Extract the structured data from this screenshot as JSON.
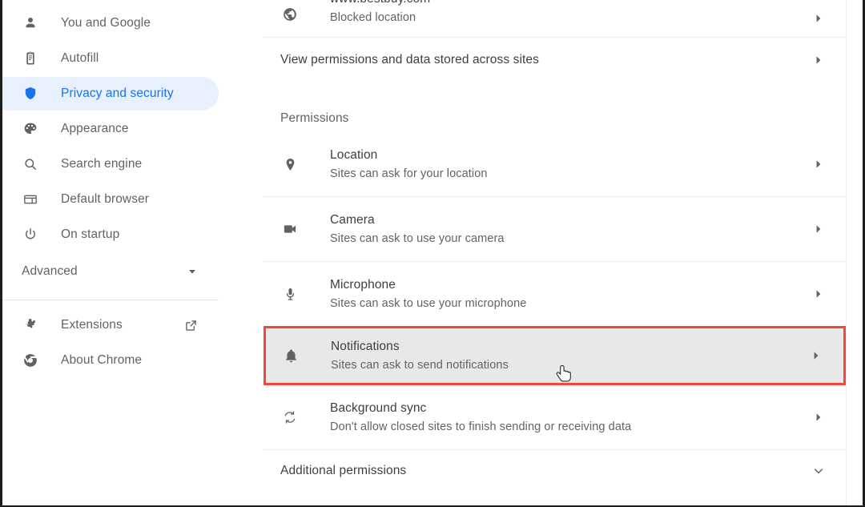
{
  "sidebar": {
    "items": [
      {
        "label": "You and Google",
        "icon": "person-icon",
        "selected": false
      },
      {
        "label": "Autofill",
        "icon": "clipboard-icon",
        "selected": false
      },
      {
        "label": "Privacy and security",
        "icon": "shield-icon",
        "selected": true
      },
      {
        "label": "Appearance",
        "icon": "palette-icon",
        "selected": false
      },
      {
        "label": "Search engine",
        "icon": "search-icon",
        "selected": false
      },
      {
        "label": "Default browser",
        "icon": "browser-window-icon",
        "selected": false
      },
      {
        "label": "On startup",
        "icon": "power-icon",
        "selected": false
      }
    ],
    "advanced": {
      "label": "Advanced",
      "icon": "chevron-down-icon"
    },
    "footer": [
      {
        "label": "Extensions",
        "icon": "puzzle-icon",
        "trailing_icon": "external-link-icon"
      },
      {
        "label": "About Chrome",
        "icon": "chrome-logo-icon"
      }
    ],
    "selected_accent": "#1a73e8",
    "selected_background": "#e8f0fe"
  },
  "main": {
    "site_row": {
      "title": "www.bestbuy.com",
      "subtitle": "Blocked location",
      "icon": "globe-icon",
      "arrow": "chevron-right-icon"
    },
    "view_permissions": {
      "label": "View permissions and data stored across sites",
      "arrow": "chevron-right-icon"
    },
    "permissions_heading": "Permissions",
    "permissions": [
      {
        "name": "location",
        "title": "Location",
        "subtitle": "Sites can ask for your location",
        "icon": "location-pin-icon",
        "arrow": "chevron-right-icon",
        "highlighted": false
      },
      {
        "name": "camera",
        "title": "Camera",
        "subtitle": "Sites can ask to use your camera",
        "icon": "video-camera-icon",
        "arrow": "chevron-right-icon",
        "highlighted": false
      },
      {
        "name": "microphone",
        "title": "Microphone",
        "subtitle": "Sites can ask to use your microphone",
        "icon": "microphone-icon",
        "arrow": "chevron-right-icon",
        "highlighted": false
      },
      {
        "name": "notifications",
        "title": "Notifications",
        "subtitle": "Sites can ask to send notifications",
        "icon": "bell-icon",
        "arrow": "chevron-right-icon",
        "highlighted": true
      },
      {
        "name": "background-sync",
        "title": "Background sync",
        "subtitle": "Don't allow closed sites to finish sending or receiving data",
        "icon": "sync-icon",
        "arrow": "chevron-right-icon",
        "highlighted": false
      }
    ],
    "additional_permissions": {
      "label": "Additional permissions",
      "arrow": "chevron-down-icon"
    },
    "highlight_color": "#f4463c",
    "hover_background": "#e8e8e8",
    "cursor": "pointing-hand-cursor"
  }
}
